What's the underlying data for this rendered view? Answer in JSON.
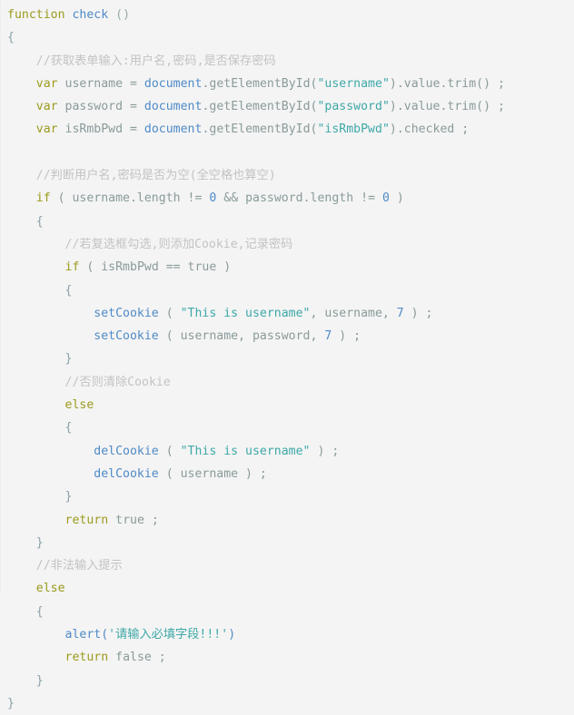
{
  "document": {
    "kind": "code-snippet",
    "language": "javascript",
    "background_color": "#f4f4f4",
    "line_count": 26
  },
  "theme": {
    "keyword_color": "#9b9b1e",
    "function_color": "#4f8ac7",
    "identifier_color": "#8a9a9a",
    "string_color": "#3fa8a8",
    "number_color": "#4f8ac7",
    "comment_color": "#c3c3c3",
    "punctuation_color": "#97a8a8",
    "brace_color": "#8aa0a8"
  },
  "code": {
    "lines": [
      {
        "indent": 0,
        "tokens": [
          {
            "t": "function",
            "c": "kw"
          },
          {
            "t": " ",
            "c": "plain"
          },
          {
            "t": "check",
            "c": "fn"
          },
          {
            "t": " ",
            "c": "plain"
          },
          {
            "t": "()",
            "c": "punc"
          }
        ]
      },
      {
        "indent": 0,
        "tokens": [
          {
            "t": "{",
            "c": "brace"
          }
        ]
      },
      {
        "indent": 1,
        "tokens": [
          {
            "t": "//获取表单输入:用户名,密码,是否保存密码",
            "c": "cmt"
          }
        ]
      },
      {
        "indent": 1,
        "tokens": [
          {
            "t": "var",
            "c": "kw"
          },
          {
            "t": " username ",
            "c": "id"
          },
          {
            "t": "=",
            "c": "op"
          },
          {
            "t": " ",
            "c": "plain"
          },
          {
            "t": "document",
            "c": "fn"
          },
          {
            "t": ".getElementById(",
            "c": "id"
          },
          {
            "t": "\"username\"",
            "c": "str"
          },
          {
            "t": ").value.trim() ;",
            "c": "id"
          }
        ]
      },
      {
        "indent": 1,
        "tokens": [
          {
            "t": "var",
            "c": "kw"
          },
          {
            "t": " password ",
            "c": "id"
          },
          {
            "t": "=",
            "c": "op"
          },
          {
            "t": " ",
            "c": "plain"
          },
          {
            "t": "document",
            "c": "fn"
          },
          {
            "t": ".getElementById(",
            "c": "id"
          },
          {
            "t": "\"password\"",
            "c": "str"
          },
          {
            "t": ").value.trim() ;",
            "c": "id"
          }
        ]
      },
      {
        "indent": 1,
        "tokens": [
          {
            "t": "var",
            "c": "kw"
          },
          {
            "t": " isRmbPwd ",
            "c": "id"
          },
          {
            "t": "=",
            "c": "op"
          },
          {
            "t": " ",
            "c": "plain"
          },
          {
            "t": "document",
            "c": "fn"
          },
          {
            "t": ".getElementById(",
            "c": "id"
          },
          {
            "t": "\"isRmbPwd\"",
            "c": "str"
          },
          {
            "t": ").checked ;",
            "c": "id"
          }
        ]
      },
      {
        "indent": 0,
        "tokens": []
      },
      {
        "indent": 1,
        "tokens": [
          {
            "t": "//判断用户名,密码是否为空(全空格也算空)",
            "c": "cmt"
          }
        ]
      },
      {
        "indent": 1,
        "tokens": [
          {
            "t": "if",
            "c": "kw"
          },
          {
            "t": " ( username.length ",
            "c": "id"
          },
          {
            "t": "!=",
            "c": "op"
          },
          {
            "t": " ",
            "c": "plain"
          },
          {
            "t": "0",
            "c": "num"
          },
          {
            "t": " ",
            "c": "plain"
          },
          {
            "t": "&&",
            "c": "op"
          },
          {
            "t": " password.length ",
            "c": "id"
          },
          {
            "t": "!=",
            "c": "op"
          },
          {
            "t": " ",
            "c": "plain"
          },
          {
            "t": "0",
            "c": "num"
          },
          {
            "t": " )",
            "c": "id"
          }
        ]
      },
      {
        "indent": 1,
        "tokens": [
          {
            "t": "{",
            "c": "brace"
          }
        ]
      },
      {
        "indent": 2,
        "tokens": [
          {
            "t": "//若复选框勾选,则添加Cookie,记录密码",
            "c": "cmt"
          }
        ]
      },
      {
        "indent": 2,
        "tokens": [
          {
            "t": "if",
            "c": "kw"
          },
          {
            "t": " ( isRmbPwd ",
            "c": "id"
          },
          {
            "t": "==",
            "c": "op"
          },
          {
            "t": " ",
            "c": "plain"
          },
          {
            "t": "true",
            "c": "bool"
          },
          {
            "t": " )",
            "c": "id"
          }
        ]
      },
      {
        "indent": 2,
        "tokens": [
          {
            "t": "{",
            "c": "brace"
          }
        ]
      },
      {
        "indent": 3,
        "tokens": [
          {
            "t": "setCookie",
            "c": "fn"
          },
          {
            "t": " ( ",
            "c": "id"
          },
          {
            "t": "\"This is username\"",
            "c": "str"
          },
          {
            "t": ", username, ",
            "c": "id"
          },
          {
            "t": "7",
            "c": "num"
          },
          {
            "t": " ) ;",
            "c": "id"
          }
        ]
      },
      {
        "indent": 3,
        "tokens": [
          {
            "t": "setCookie",
            "c": "fn"
          },
          {
            "t": " ( username, password, ",
            "c": "id"
          },
          {
            "t": "7",
            "c": "num"
          },
          {
            "t": " ) ;",
            "c": "id"
          }
        ]
      },
      {
        "indent": 2,
        "tokens": [
          {
            "t": "}",
            "c": "brace"
          }
        ]
      },
      {
        "indent": 2,
        "tokens": [
          {
            "t": "//否则清除Cookie",
            "c": "cmt"
          }
        ]
      },
      {
        "indent": 2,
        "tokens": [
          {
            "t": "else",
            "c": "kw"
          }
        ]
      },
      {
        "indent": 2,
        "tokens": [
          {
            "t": "{",
            "c": "brace"
          }
        ]
      },
      {
        "indent": 3,
        "tokens": [
          {
            "t": "delCookie",
            "c": "fn"
          },
          {
            "t": " ( ",
            "c": "id"
          },
          {
            "t": "\"This is username\"",
            "c": "str"
          },
          {
            "t": " ) ;",
            "c": "id"
          }
        ]
      },
      {
        "indent": 3,
        "tokens": [
          {
            "t": "delCookie",
            "c": "fn"
          },
          {
            "t": " ( username ) ;",
            "c": "id"
          }
        ]
      },
      {
        "indent": 2,
        "tokens": [
          {
            "t": "}",
            "c": "brace"
          }
        ]
      },
      {
        "indent": 2,
        "tokens": [
          {
            "t": "return",
            "c": "kw"
          },
          {
            "t": " ",
            "c": "plain"
          },
          {
            "t": "true",
            "c": "bool"
          },
          {
            "t": " ;",
            "c": "id"
          }
        ]
      },
      {
        "indent": 1,
        "tokens": [
          {
            "t": "}",
            "c": "brace"
          }
        ]
      },
      {
        "indent": 1,
        "tokens": [
          {
            "t": "//非法输入提示",
            "c": "cmt"
          }
        ]
      },
      {
        "indent": 1,
        "tokens": [
          {
            "t": "else",
            "c": "kw"
          }
        ]
      },
      {
        "indent": 1,
        "tokens": [
          {
            "t": "{",
            "c": "brace"
          }
        ]
      },
      {
        "indent": 2,
        "tokens": [
          {
            "t": "alert(",
            "c": "fn"
          },
          {
            "t": "'请输入必填字段!!!'",
            "c": "str"
          },
          {
            "t": ")",
            "c": "fn"
          }
        ]
      },
      {
        "indent": 2,
        "tokens": [
          {
            "t": "return",
            "c": "kw"
          },
          {
            "t": " ",
            "c": "plain"
          },
          {
            "t": "false",
            "c": "bool"
          },
          {
            "t": " ;",
            "c": "id"
          }
        ]
      },
      {
        "indent": 1,
        "tokens": [
          {
            "t": "}",
            "c": "brace"
          }
        ]
      },
      {
        "indent": 0,
        "tokens": [
          {
            "t": "}",
            "c": "brace"
          }
        ]
      }
    ]
  }
}
